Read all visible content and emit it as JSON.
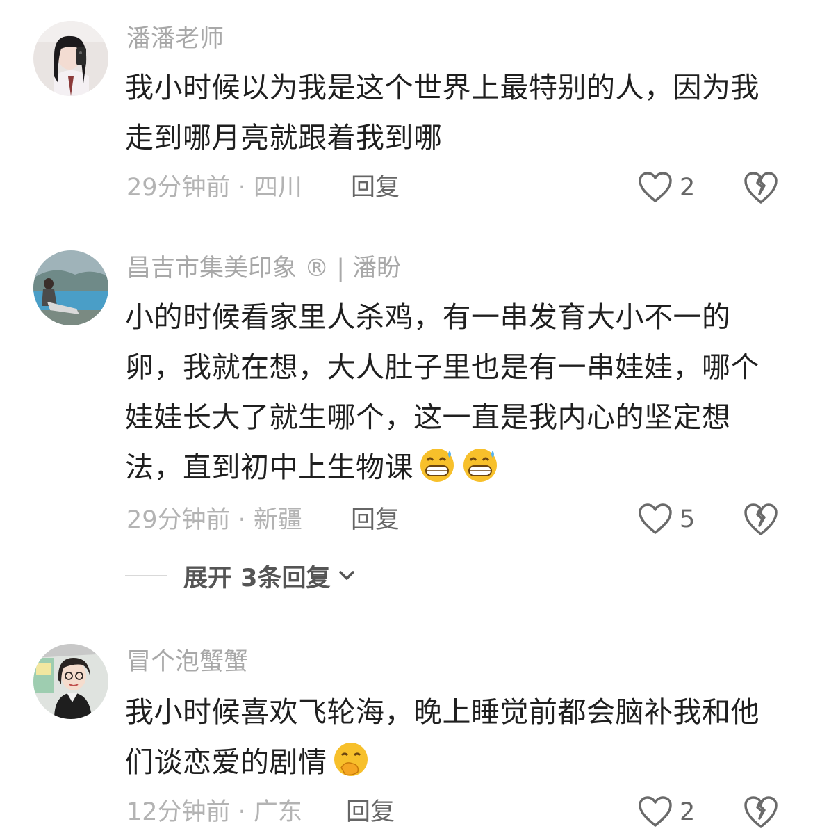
{
  "comments": [
    {
      "username": "潘潘老师",
      "text": "我小时候以为我是这个世界上最特别的人，因为我走到哪月亮就跟着我到哪",
      "meta": "29分钟前 · 四川",
      "reply_label": "回复",
      "likes": "2",
      "avatar_icon": "avatar-photo-girl-selfie",
      "like_icon": "heart-outline-icon",
      "dislike_icon": "broken-heart-icon"
    },
    {
      "username": "昌吉市集美印象 ® | 潘盼",
      "text": "小的时候看家里人杀鸡，有一串发育大小不一的卵，我就在想，大人肚子里也是有一串娃娃，哪个娃娃长大了就生哪个，这一直是我内心的坚定想法，直到初中上生物课",
      "emojis": [
        "grinning-sweat-emoji",
        "grinning-sweat-emoji"
      ],
      "meta": "29分钟前 · 新疆",
      "reply_label": "回复",
      "likes": "5",
      "avatar_icon": "avatar-photo-lake",
      "like_icon": "heart-outline-icon",
      "dislike_icon": "broken-heart-icon"
    },
    {
      "username": "冒个泡蟹蟹",
      "text": "我小时候喜欢飞轮海，晚上睡觉前都会脑补我和他们谈恋爱的剧情",
      "emojis": [
        "hand-over-mouth-emoji"
      ],
      "meta": "12分钟前 · 广东",
      "reply_label": "回复",
      "likes": "2",
      "avatar_icon": "avatar-photo-cartoon-girl",
      "like_icon": "heart-outline-icon",
      "dislike_icon": "broken-heart-icon"
    }
  ],
  "expand_replies": {
    "label": "展开 3条回复",
    "icon": "chevron-down-icon"
  },
  "colors": {
    "username": "#a8a8a8",
    "meta": "#b3b3b3",
    "text": "#1f1f1f",
    "emoji": "#f7c02b"
  }
}
